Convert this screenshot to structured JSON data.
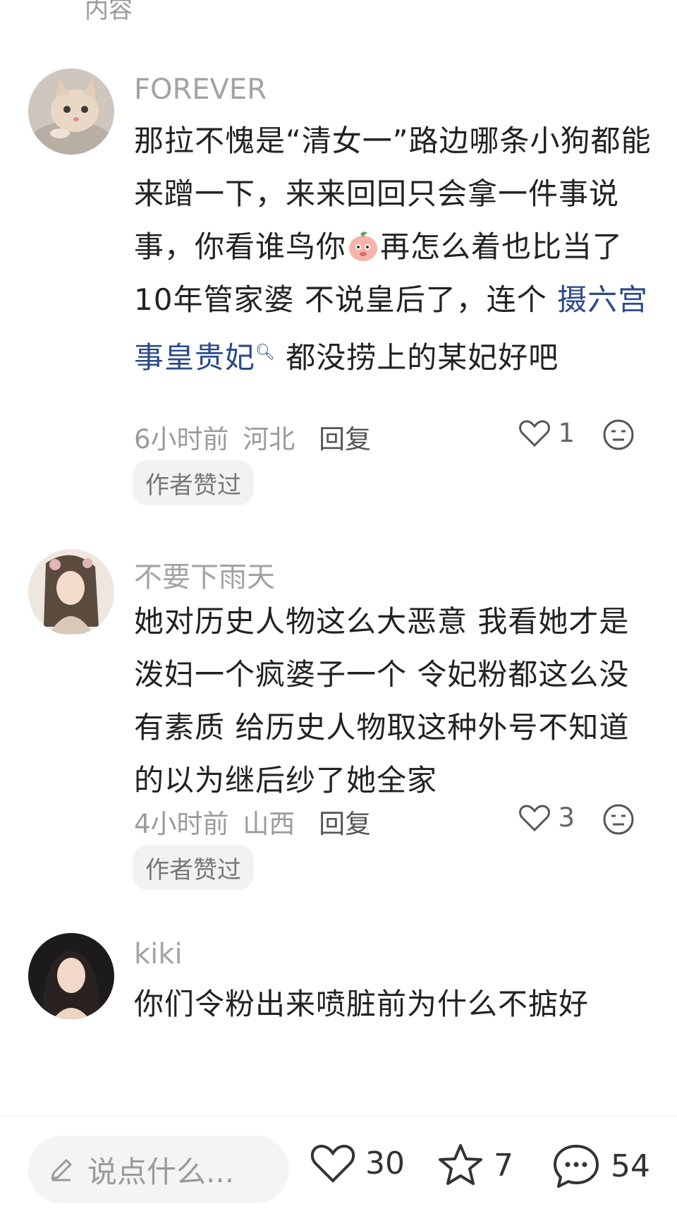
{
  "top_fragment": "内容",
  "comments": [
    {
      "username": "FOREVER",
      "text_part1": "那拉不愧是“清女一”路边哪条小狗都能来蹭一下，来来回回只会拿一件事说事，你看谁鸟你",
      "text_part2": "再怎么着也比当了10年管家婆 不说皇后了，连个 ",
      "link_text": "摄六宫事皇贵妃",
      "text_part3": " 都没捞上的某妃好吧",
      "time": "6小时前",
      "location": "河北",
      "reply_label": "回复",
      "likes": "1",
      "badge": "作者赞过"
    },
    {
      "username": "不要下雨天",
      "text": "她对历史人物这么大恶意 我看她才是泼妇一个疯婆子一个 令妃粉都这么没有素质 给历史人物取这种外号不知道的以为继后纱了她全家",
      "time": "4小时前",
      "location": "山西",
      "reply_label": "回复",
      "likes": "3",
      "badge": "作者赞过"
    },
    {
      "username": "kiki",
      "text": "你们令粉出来喷脏前为什么不掂好"
    }
  ],
  "bottom_bar": {
    "input_placeholder": "说点什么...",
    "likes": "30",
    "favorites": "7",
    "comments": "54"
  },
  "icons": {
    "pencil": "pencil-icon",
    "heart": "heart-icon",
    "star": "star-icon",
    "chat": "chat-bubble-icon",
    "dislike": "meh-face-icon",
    "emoji": "peach-emoji-icon"
  },
  "colors": {
    "link": "#2b4a8a",
    "muted": "#9b9b9b"
  }
}
